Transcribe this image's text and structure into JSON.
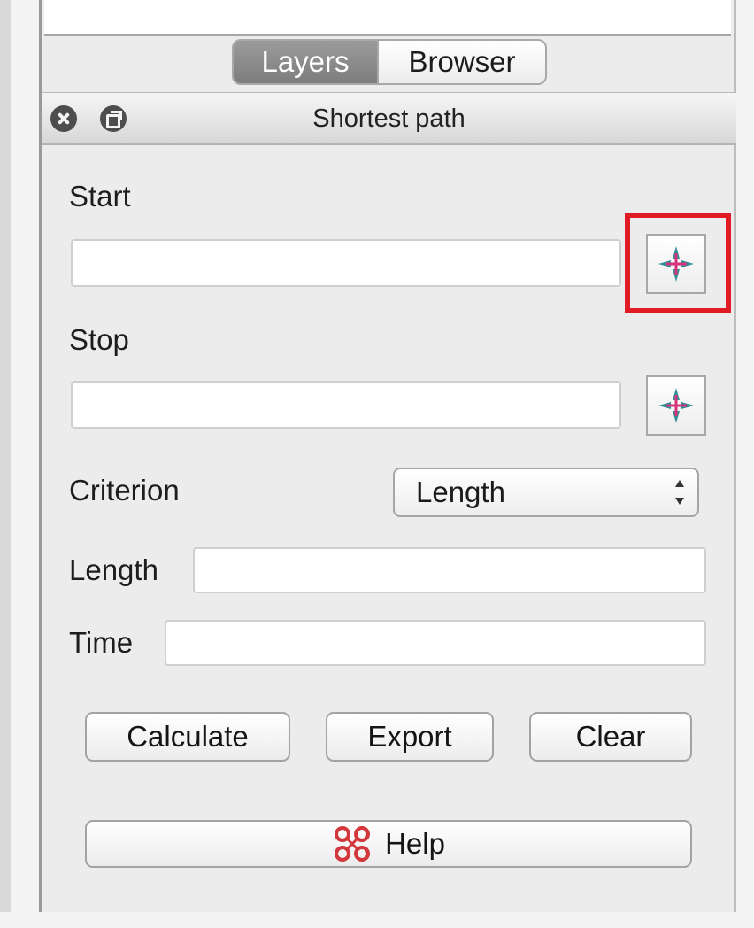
{
  "tabs": [
    {
      "label": "Layers",
      "active": true
    },
    {
      "label": "Browser",
      "active": false
    }
  ],
  "dock": {
    "title": "Shortest path",
    "close_icon": "close-icon",
    "float_icon": "float-window-icon"
  },
  "form": {
    "start_label": "Start",
    "start_value": "",
    "stop_label": "Stop",
    "stop_value": "",
    "criterion_label": "Criterion",
    "criterion_value": "Length",
    "length_label": "Length",
    "length_value": "",
    "time_label": "Time",
    "time_value": "",
    "point_picker_icon": "crosshair-icon"
  },
  "actions": {
    "calculate_label": "Calculate",
    "export_label": "Export",
    "clear_label": "Clear",
    "help_label": "Help",
    "help_icon": "help-icon"
  },
  "colors": {
    "highlight": "#e01b24",
    "crosshair_teal": "#2f8f98",
    "crosshair_red": "#d6337a"
  }
}
